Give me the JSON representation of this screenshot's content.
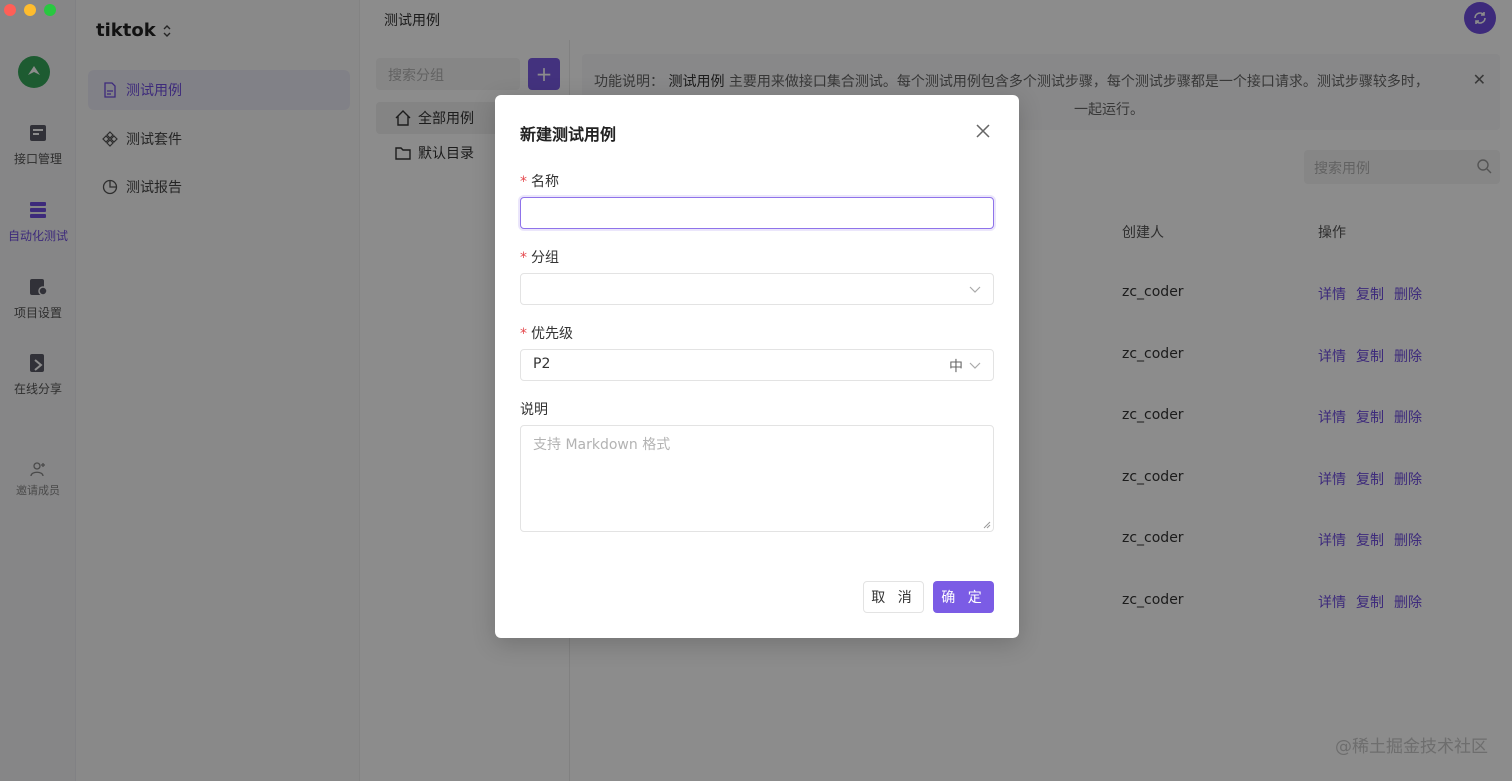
{
  "window": {
    "traffic_colors": [
      "#ff5f57",
      "#febc2e",
      "#28c840"
    ]
  },
  "rail": {
    "items": [
      {
        "label": "接口管理",
        "icon": "api-icon"
      },
      {
        "label": "自动化测试",
        "icon": "automation-icon"
      },
      {
        "label": "项目设置",
        "icon": "project-settings-icon"
      },
      {
        "label": "在线分享",
        "icon": "share-icon"
      },
      {
        "label": "邀请成员",
        "icon": "invite-icon"
      }
    ]
  },
  "nav": {
    "project": "tiktok",
    "items": [
      {
        "label": "测试用例",
        "icon": "file-icon"
      },
      {
        "label": "测试套件",
        "icon": "suite-icon"
      },
      {
        "label": "测试报告",
        "icon": "chart-icon"
      }
    ]
  },
  "topbar": {
    "title": "测试用例"
  },
  "tree": {
    "search_placeholder": "搜索分组",
    "add": "+",
    "items": [
      {
        "label": "全部用例",
        "icon": "home-icon"
      },
      {
        "label": "默认目录",
        "icon": "folder-icon"
      }
    ]
  },
  "content": {
    "notice_prefix": "功能说明：",
    "notice_key": "测试用例",
    "notice_line1": "主要用来做接口集合测试。每个测试用例包含多个测试步骤，每个测试步骤都是一个接口请求。测试步骤较多时，",
    "notice_line2": "一起运行。",
    "search_placeholder": "搜索用例",
    "columns": {
      "creator": "创建人",
      "actions": "操作"
    },
    "rows": [
      {
        "creator": "zc_coder"
      },
      {
        "creator": "zc_coder"
      },
      {
        "creator": "zc_coder"
      },
      {
        "creator": "zc_coder"
      },
      {
        "creator": "zc_coder"
      },
      {
        "creator": "zc_coder"
      }
    ],
    "actions": {
      "detail": "详情",
      "copy": "复制",
      "delete": "删除"
    }
  },
  "watermark": "@稀土掘金技术社区",
  "modal": {
    "title": "新建测试用例",
    "fields": {
      "name": {
        "label": "名称",
        "value": ""
      },
      "group": {
        "label": "分组",
        "value": ""
      },
      "priority": {
        "label": "优先级",
        "value": "P2",
        "suffix": "中"
      },
      "description": {
        "label": "说明",
        "placeholder": "支持 Markdown 格式"
      }
    },
    "required_mark": "*",
    "cancel": "取 消",
    "ok": "确 定"
  },
  "colors": {
    "accent": "#7b5ce5",
    "required": "#e5484d"
  }
}
